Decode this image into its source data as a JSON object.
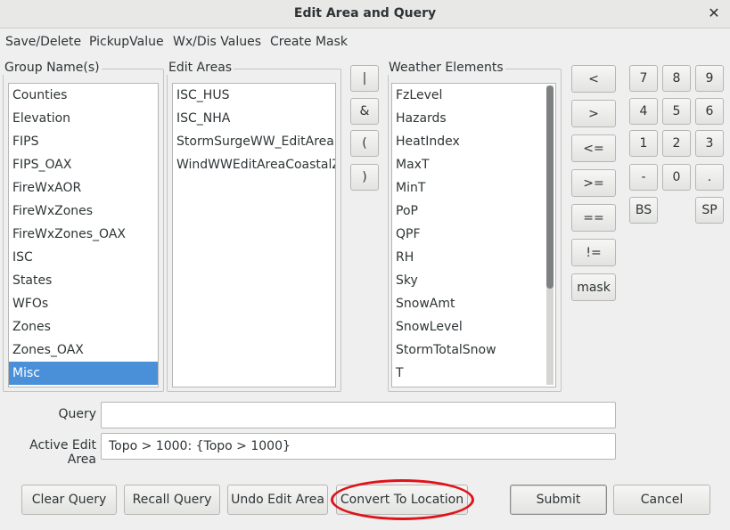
{
  "window": {
    "title": "Edit Area and Query",
    "close_glyph": "✕"
  },
  "menu": [
    "Save/Delete",
    "PickupValue",
    "Wx/Dis Values",
    "Create Mask"
  ],
  "group_names": {
    "label": "Group Name(s)",
    "items": [
      "Counties",
      "Elevation",
      "FIPS",
      "FIPS_OAX",
      "FireWxAOR",
      "FireWxZones",
      "FireWxZones_OAX",
      "ISC",
      "States",
      "WFOs",
      "Zones",
      "Zones_OAX",
      "Misc"
    ],
    "selected": "Misc"
  },
  "edit_areas": {
    "label": "Edit Areas",
    "items": [
      "ISC_HUS",
      "ISC_NHA",
      "StormSurgeWW_EditArea",
      "WindWWEditAreaCoastalZo"
    ]
  },
  "operators": [
    "|",
    "&",
    "(",
    ")"
  ],
  "weather_elements": {
    "label": "Weather Elements",
    "items": [
      "FzLevel",
      "Hazards",
      "HeatIndex",
      "MaxT",
      "MinT",
      "PoP",
      "QPF",
      "RH",
      "Sky",
      "SnowAmt",
      "SnowLevel",
      "StormTotalSnow",
      "T"
    ]
  },
  "comparators": [
    "<",
    ">",
    "<=",
    ">=",
    "==",
    "!=",
    "mask"
  ],
  "keypad": {
    "rows": [
      [
        "7",
        "8",
        "9"
      ],
      [
        "4",
        "5",
        "6"
      ],
      [
        "1",
        "2",
        "3"
      ],
      [
        "-",
        "0",
        "."
      ]
    ],
    "bs": "BS",
    "sp": "SP"
  },
  "query": {
    "label": "Query",
    "value": ""
  },
  "active_edit_area": {
    "label": "Active Edit Area",
    "value": "Topo > 1000: {Topo > 1000}"
  },
  "buttons": {
    "clear_query": "Clear Query",
    "recall_query": "Recall Query",
    "undo_edit_area": "Undo Edit Area",
    "convert_to_location": "Convert To Location",
    "submit": "Submit",
    "cancel": "Cancel"
  },
  "colors": {
    "selection": "#4a90d9",
    "annotation_ring": "#e0121a"
  }
}
